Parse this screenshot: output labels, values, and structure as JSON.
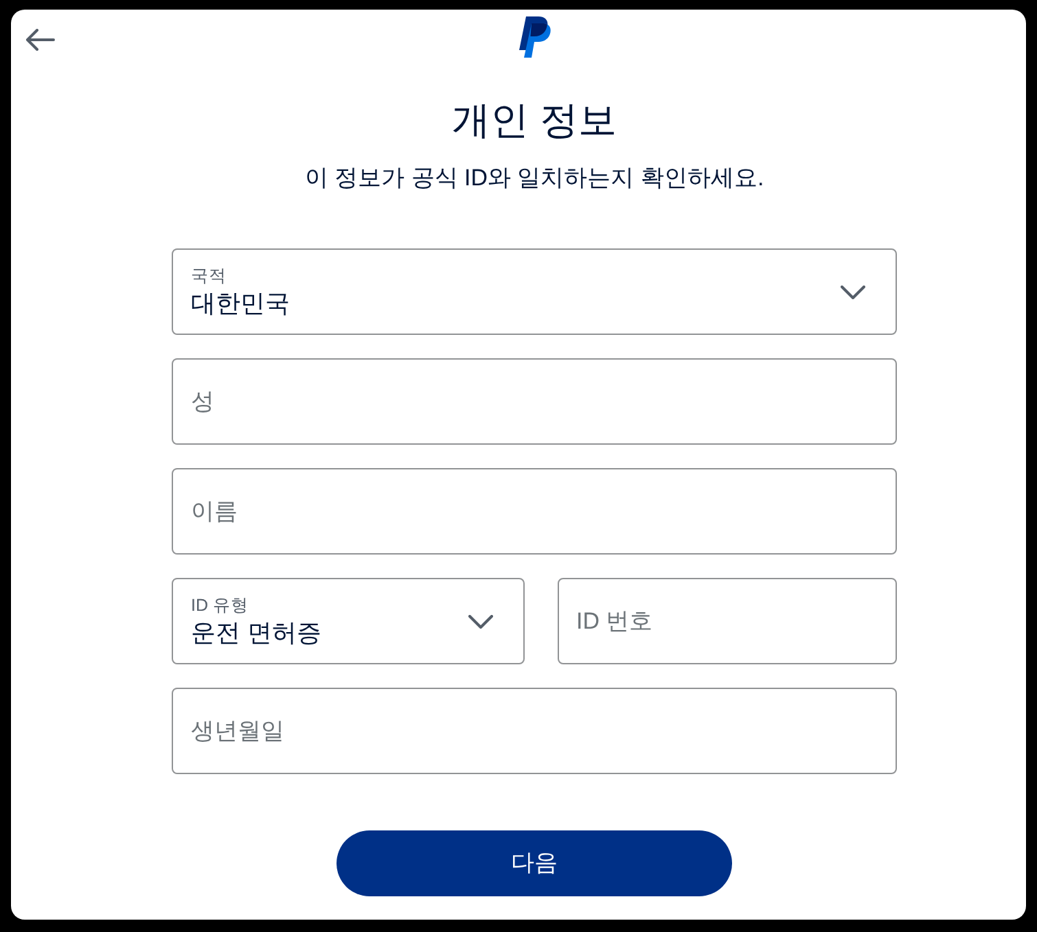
{
  "title": "개인 정보",
  "subtitle": "이 정보가 공식 ID와 일치하는지 확인하세요.",
  "form_rows": [
    [
      {
        "kind": "select",
        "label": "국적",
        "value": "대한민국"
      }
    ],
    [
      {
        "kind": "text",
        "placeholder": "성"
      }
    ],
    [
      {
        "kind": "text",
        "placeholder": "이름"
      }
    ],
    [
      {
        "kind": "select",
        "label": "ID 유형",
        "value": "운전 면허증"
      },
      {
        "kind": "text",
        "placeholder": "ID 번호"
      }
    ],
    [
      {
        "kind": "text",
        "placeholder": "생년월일"
      }
    ]
  ],
  "next_button": {
    "label": "다음"
  }
}
